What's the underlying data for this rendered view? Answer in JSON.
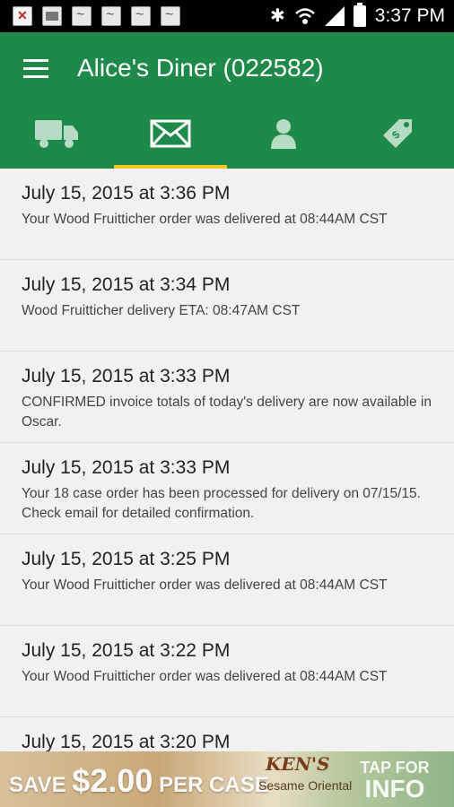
{
  "status_bar": {
    "time": "3:37 PM",
    "notification_icons": [
      "error-icon",
      "image-icon",
      "signature-icon",
      "signature-icon",
      "signature-icon",
      "signature-icon"
    ],
    "system_icons": [
      "bluetooth-icon",
      "wifi-icon",
      "cell-signal-icon",
      "battery-icon"
    ]
  },
  "app_bar": {
    "title": "Alice's Diner (022582)",
    "color": "#1e8a4a"
  },
  "tabs": [
    {
      "icon": "truck-icon",
      "active": false
    },
    {
      "icon": "mail-icon",
      "active": true
    },
    {
      "icon": "person-icon",
      "active": false
    },
    {
      "icon": "price-tag-icon",
      "active": false
    }
  ],
  "accent_color": "#f3c623",
  "messages": [
    {
      "date": "July 15, 2015 at 3:36 PM",
      "body": "Your Wood Fruitticher order was delivered at 08:44AM CST"
    },
    {
      "date": "July 15, 2015 at 3:34 PM",
      "body": "Wood Fruitticher delivery ETA: 08:47AM CST"
    },
    {
      "date": "July 15, 2015 at 3:33 PM",
      "body": "CONFIRMED invoice totals of today's delivery are now available in Oscar."
    },
    {
      "date": "July 15, 2015 at 3:33 PM",
      "body": "Your 18 case order has been processed for delivery on 07/15/15. Check email for detailed confirmation."
    },
    {
      "date": "July 15, 2015 at 3:25 PM",
      "body": "Your Wood Fruitticher order was delivered at 08:44AM CST"
    },
    {
      "date": "July 15, 2015 at 3:22 PM",
      "body": "Your Wood Fruitticher order was delivered at 08:44AM CST"
    },
    {
      "date": "July 15, 2015 at 3:20 PM",
      "body": ""
    }
  ],
  "ad_banner": {
    "save_text": "SAVE",
    "amount": "$2.00",
    "per_case": "PER CASE",
    "brand": "KEN'S",
    "product": "Sesame Oriental",
    "cta_line1": "TAP FOR",
    "cta_line2": "INFO"
  }
}
